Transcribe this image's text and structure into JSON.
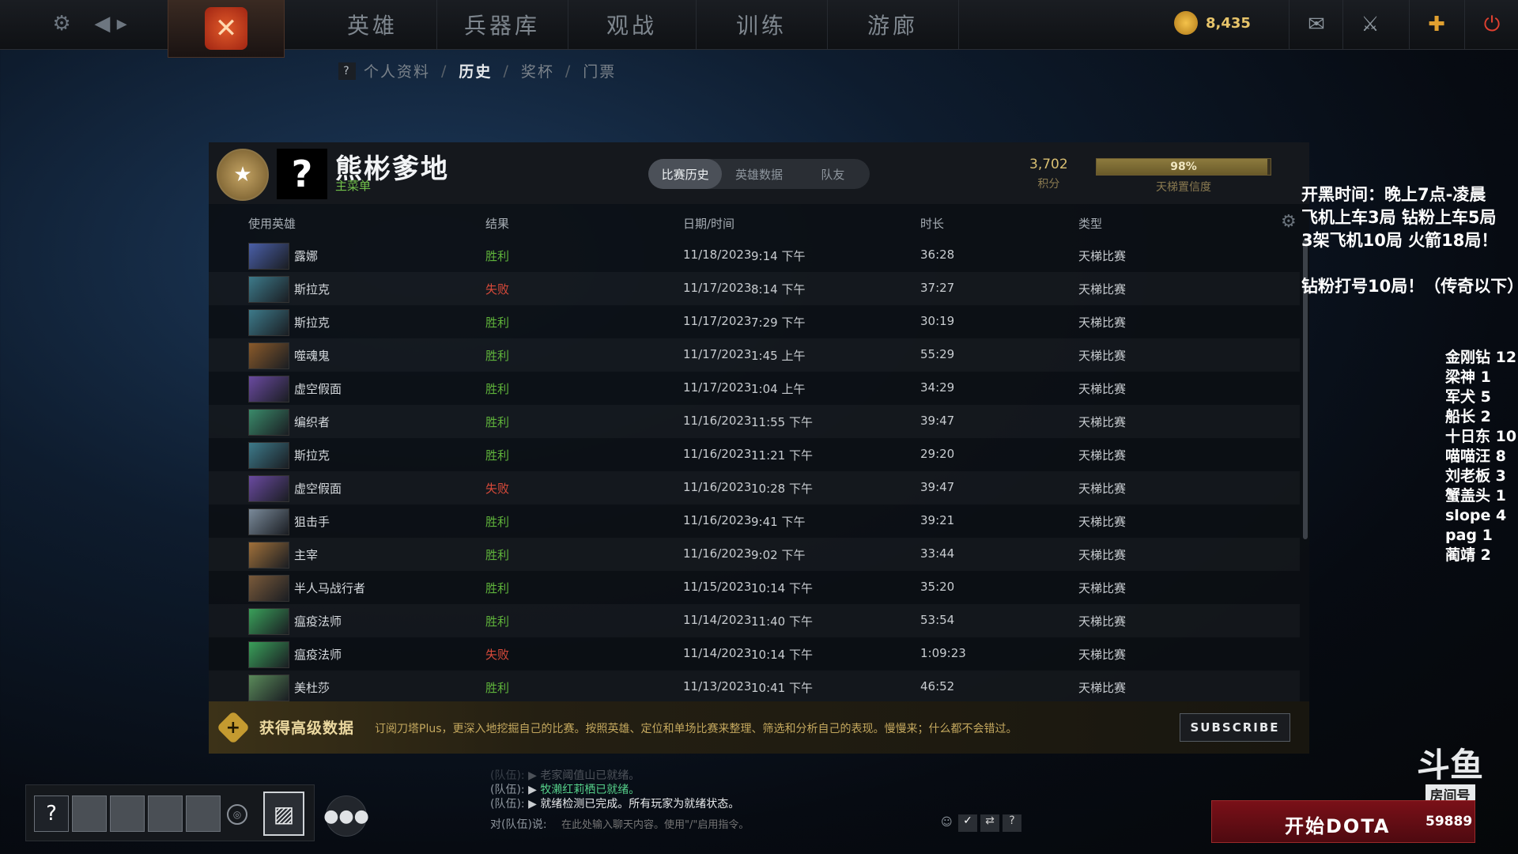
{
  "topbar": {
    "nav_tabs": [
      "英雄",
      "兵器库",
      "观战",
      "训练",
      "游廊"
    ],
    "gold": "8,435"
  },
  "breadcrumb": {
    "help": "?",
    "items": [
      "个人资料",
      "历史",
      "奖杯",
      "门票"
    ],
    "sep": "/"
  },
  "profile": {
    "avatar_char": "?",
    "name": "熊彬爹地",
    "subtitle": "主菜单",
    "tabs": [
      "比赛历史",
      "英雄数据",
      "队友"
    ],
    "score_value": "3,702",
    "score_label": "积分",
    "confidence_value": "98%",
    "confidence_fraction": 0.98,
    "confidence_label": "天梯置信度"
  },
  "table": {
    "headers": [
      "使用英雄",
      "结果",
      "日期/时间",
      "时长",
      "类型"
    ],
    "rows": [
      {
        "hero": "露娜",
        "result": "胜利",
        "win": true,
        "date": "11/18/2023",
        "time": "9:14 下午",
        "duration": "36:28",
        "type": "天梯比赛",
        "color": "#4a5fa8"
      },
      {
        "hero": "斯拉克",
        "result": "失败",
        "win": false,
        "date": "11/17/2023",
        "time": "8:14 下午",
        "duration": "37:27",
        "type": "天梯比赛",
        "color": "#3d7a8a"
      },
      {
        "hero": "斯拉克",
        "result": "胜利",
        "win": true,
        "date": "11/17/2023",
        "time": "7:29 下午",
        "duration": "30:19",
        "type": "天梯比赛",
        "color": "#3d7a8a"
      },
      {
        "hero": "噬魂鬼",
        "result": "胜利",
        "win": true,
        "date": "11/17/2023",
        "time": "1:45 上午",
        "duration": "55:29",
        "type": "天梯比赛",
        "color": "#8a5a2a"
      },
      {
        "hero": "虚空假面",
        "result": "胜利",
        "win": true,
        "date": "11/17/2023",
        "time": "1:04 上午",
        "duration": "34:29",
        "type": "天梯比赛",
        "color": "#6a4aa0"
      },
      {
        "hero": "编织者",
        "result": "胜利",
        "win": true,
        "date": "11/16/2023",
        "time": "11:55 下午",
        "duration": "39:47",
        "type": "天梯比赛",
        "color": "#3a8a6a"
      },
      {
        "hero": "斯拉克",
        "result": "胜利",
        "win": true,
        "date": "11/16/2023",
        "time": "11:21 下午",
        "duration": "29:20",
        "type": "天梯比赛",
        "color": "#3d7a8a"
      },
      {
        "hero": "虚空假面",
        "result": "失败",
        "win": false,
        "date": "11/16/2023",
        "time": "10:28 下午",
        "duration": "39:47",
        "type": "天梯比赛",
        "color": "#6a4aa0"
      },
      {
        "hero": "狙击手",
        "result": "胜利",
        "win": true,
        "date": "11/16/2023",
        "time": "9:41 下午",
        "duration": "39:21",
        "type": "天梯比赛",
        "color": "#7a8a9a"
      },
      {
        "hero": "主宰",
        "result": "胜利",
        "win": true,
        "date": "11/16/2023",
        "time": "9:02 下午",
        "duration": "33:44",
        "type": "天梯比赛",
        "color": "#a0703a"
      },
      {
        "hero": "半人马战行者",
        "result": "胜利",
        "win": true,
        "date": "11/15/2023",
        "time": "10:14 下午",
        "duration": "35:20",
        "type": "天梯比赛",
        "color": "#7a5a3a"
      },
      {
        "hero": "瘟疫法师",
        "result": "胜利",
        "win": true,
        "date": "11/14/2023",
        "time": "11:40 下午",
        "duration": "53:54",
        "type": "天梯比赛",
        "color": "#3aa05a"
      },
      {
        "hero": "瘟疫法师",
        "result": "失败",
        "win": false,
        "date": "11/14/2023",
        "time": "10:14 下午",
        "duration": "1:09:23",
        "type": "天梯比赛",
        "color": "#3aa05a"
      },
      {
        "hero": "美杜莎",
        "result": "胜利",
        "win": true,
        "date": "11/13/2023",
        "time": "10:41 下午",
        "duration": "46:52",
        "type": "天梯比赛",
        "color": "#5a8a5a"
      }
    ]
  },
  "plus_banner": {
    "title": "获得高级数据",
    "description": "订阅刀塔Plus，更深入地挖掘自己的比赛。按照英雄、定位和单场比赛来整理、筛选和分析自己的表现。慢慢来；什么都不会错过。",
    "subscribe": "SUBSCRIBE"
  },
  "overlay": {
    "notes": [
      "开黑时间：晚上7点-凌晨",
      "飞机上车3局 钻粉上车5局",
      "3架飞机10局 火箭18局！",
      "",
      "钻粉打号10局！（传奇以下）"
    ],
    "tally": [
      "金刚钻 12",
      "梁神 1",
      "军犬 5",
      "船长 2",
      "十日东 10",
      "喵喵汪 8",
      "刘老板 3",
      "蟹盖头 1",
      "slope 4",
      "pag 1",
      "蔺靖 2"
    ]
  },
  "party": {
    "help": "?"
  },
  "chat": {
    "lines": [
      {
        "who": "(队伍):",
        "text": "老家阈值山已就绪。",
        "faded": true
      },
      {
        "who": "(队伍):",
        "text": "牧濑红莉栖已就绪。",
        "faded": false
      },
      {
        "who": "(队伍):",
        "text": "就绪检测已完成。所有玩家为就绪状态。",
        "faded": false
      }
    ],
    "input_label": "对(队伍)说:",
    "input_placeholder": "在此处输入聊天内容。使用\"/\"启用指令。"
  },
  "start": {
    "label": "开始DOTA",
    "room_number": "59889"
  },
  "watermark": {
    "brand": "斗鱼",
    "room": "房间号"
  }
}
